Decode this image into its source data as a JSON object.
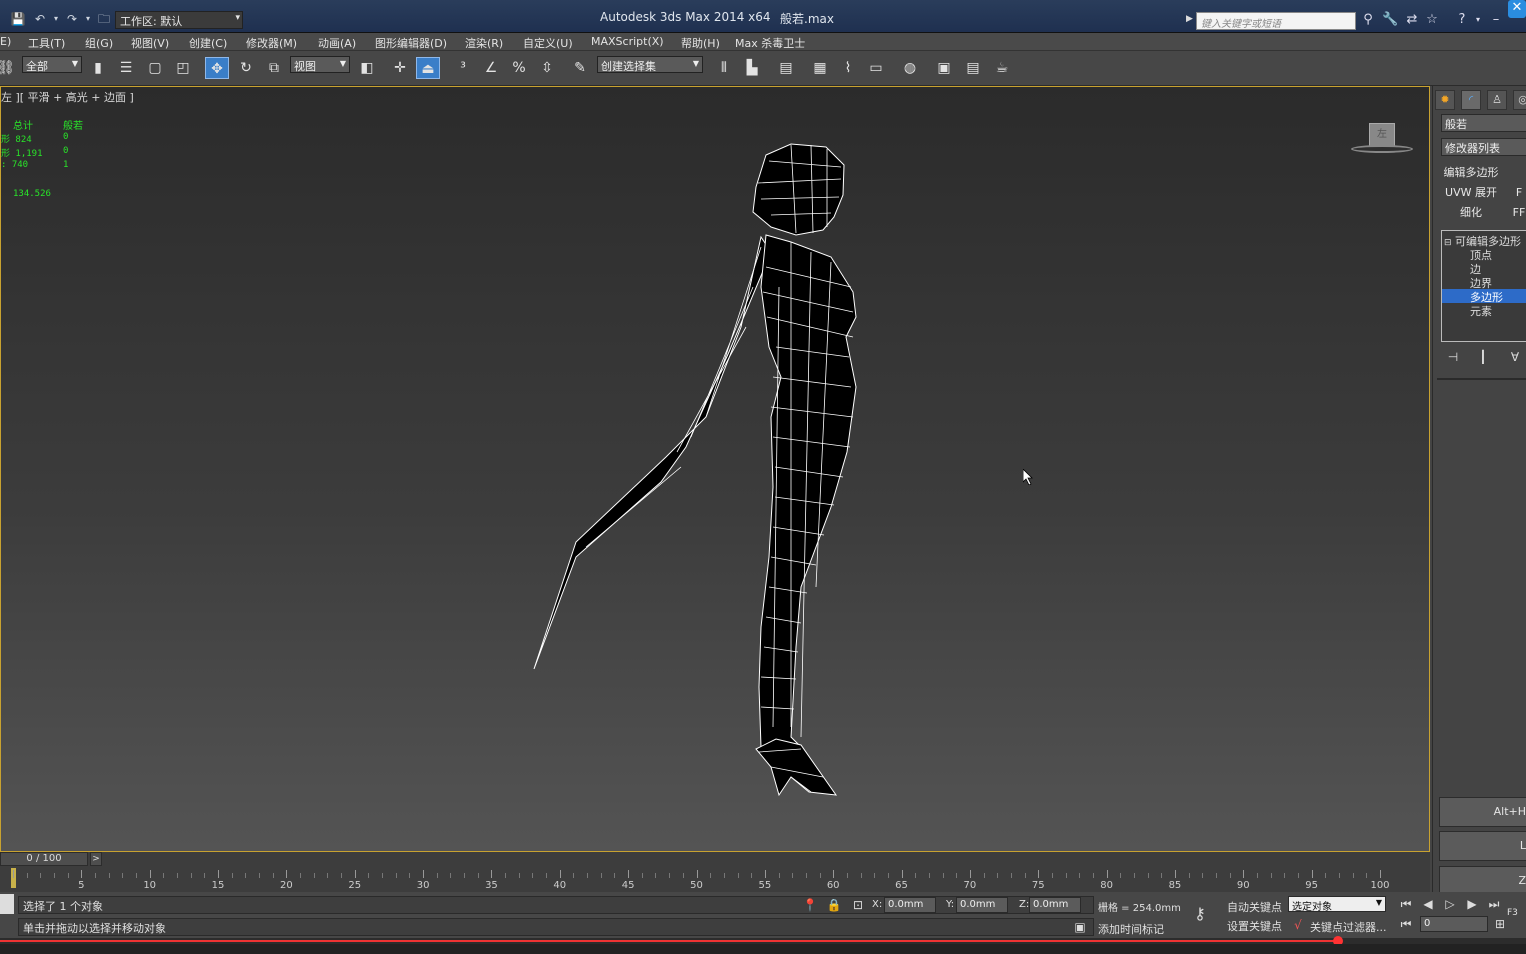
{
  "title": {
    "app": "Autodesk 3ds Max  2014 x64",
    "file": "般若.max",
    "workspace": "工作区: 默认",
    "search_placeholder": "键入关键字或短语"
  },
  "menu": [
    "E)",
    "工具(T)",
    "组(G)",
    "视图(V)",
    "创建(C)",
    "修改器(M)",
    "动画(A)",
    "图形编辑器(D)",
    "渲染(R)",
    "自定义(U)",
    "MAXScript(X)",
    "帮助(H)",
    "Max 杀毒卫士"
  ],
  "toolbar": {
    "filter": "全部",
    "ref_coord": "视图",
    "named_selection": "创建选择集"
  },
  "viewport": {
    "label": "左 ][ 平滑 + 高光 + 边面 ]",
    "stats_header": [
      "总计",
      "般若"
    ],
    "stats_rows": [
      [
        "形 824",
        "0"
      ],
      [
        "形 1,191",
        "0"
      ],
      [
        ": 740",
        "1"
      ]
    ],
    "fps": "134.526",
    "viewcube_face": "左"
  },
  "command_panel": {
    "object_name": "般若",
    "modifier_list": "修改器列表",
    "buttons": [
      "编辑多边形",
      "UVW 展开",
      "细化"
    ],
    "buttons_right": [
      "",
      "F",
      "FF"
    ],
    "stack": [
      "可编辑多边形",
      "顶点",
      "边",
      "边界",
      "多边形",
      "元素"
    ],
    "stack_selected": "多边形",
    "big_buttons": [
      "Alt+H",
      "L",
      "Z"
    ]
  },
  "timeline": {
    "position": "0 / 100",
    "labels": [
      "5",
      "10",
      "15",
      "20",
      "25",
      "30",
      "35",
      "40",
      "45",
      "50",
      "55",
      "60",
      "65",
      "70",
      "75",
      "80",
      "85",
      "90",
      "95",
      "100"
    ],
    "current_frame": 0,
    "total_frames": 100
  },
  "status": {
    "line1": "选择了 1 个对象",
    "line2": "单击并拖动以选择并移动对象",
    "x_label": "X:",
    "x": "0.0mm",
    "y_label": "Y:",
    "y": "0.0mm",
    "z_label": "Z:",
    "z": "0.0mm",
    "grid": "栅格 = 254.0mm",
    "auto_key": "自动关键点",
    "set_key": "设置关键点",
    "key_mode": "选定对象",
    "key_filters": "关键点过滤器...",
    "add_time_tag": "添加时间标记",
    "frame_field": "0",
    "f3": "F3"
  },
  "progress_fraction": 0.877
}
